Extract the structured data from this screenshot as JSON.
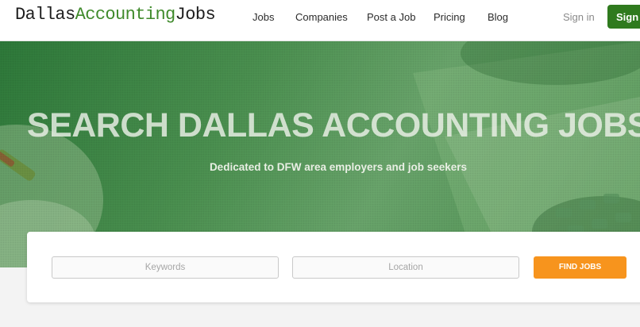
{
  "brand": {
    "logo_part1": "Dallas",
    "logo_part2": "Accounting",
    "logo_part3": "Jobs"
  },
  "nav": {
    "links": [
      "Jobs",
      "Companies",
      "Post a Job",
      "Pricing",
      "Blog"
    ],
    "signin": "Sign in",
    "signup": "Sign up"
  },
  "hero": {
    "title": "SEARCH DALLAS ACCOUNTING JOBS",
    "subtitle": "Dedicated to DFW area employers and job seekers"
  },
  "search": {
    "keywords_placeholder": "Keywords",
    "location_placeholder": "Location",
    "button_label": "FIND JOBS"
  },
  "colors": {
    "brand_green": "#3f8a2b",
    "signup_green": "#2f7a1e",
    "cta_orange": "#f7941d"
  }
}
